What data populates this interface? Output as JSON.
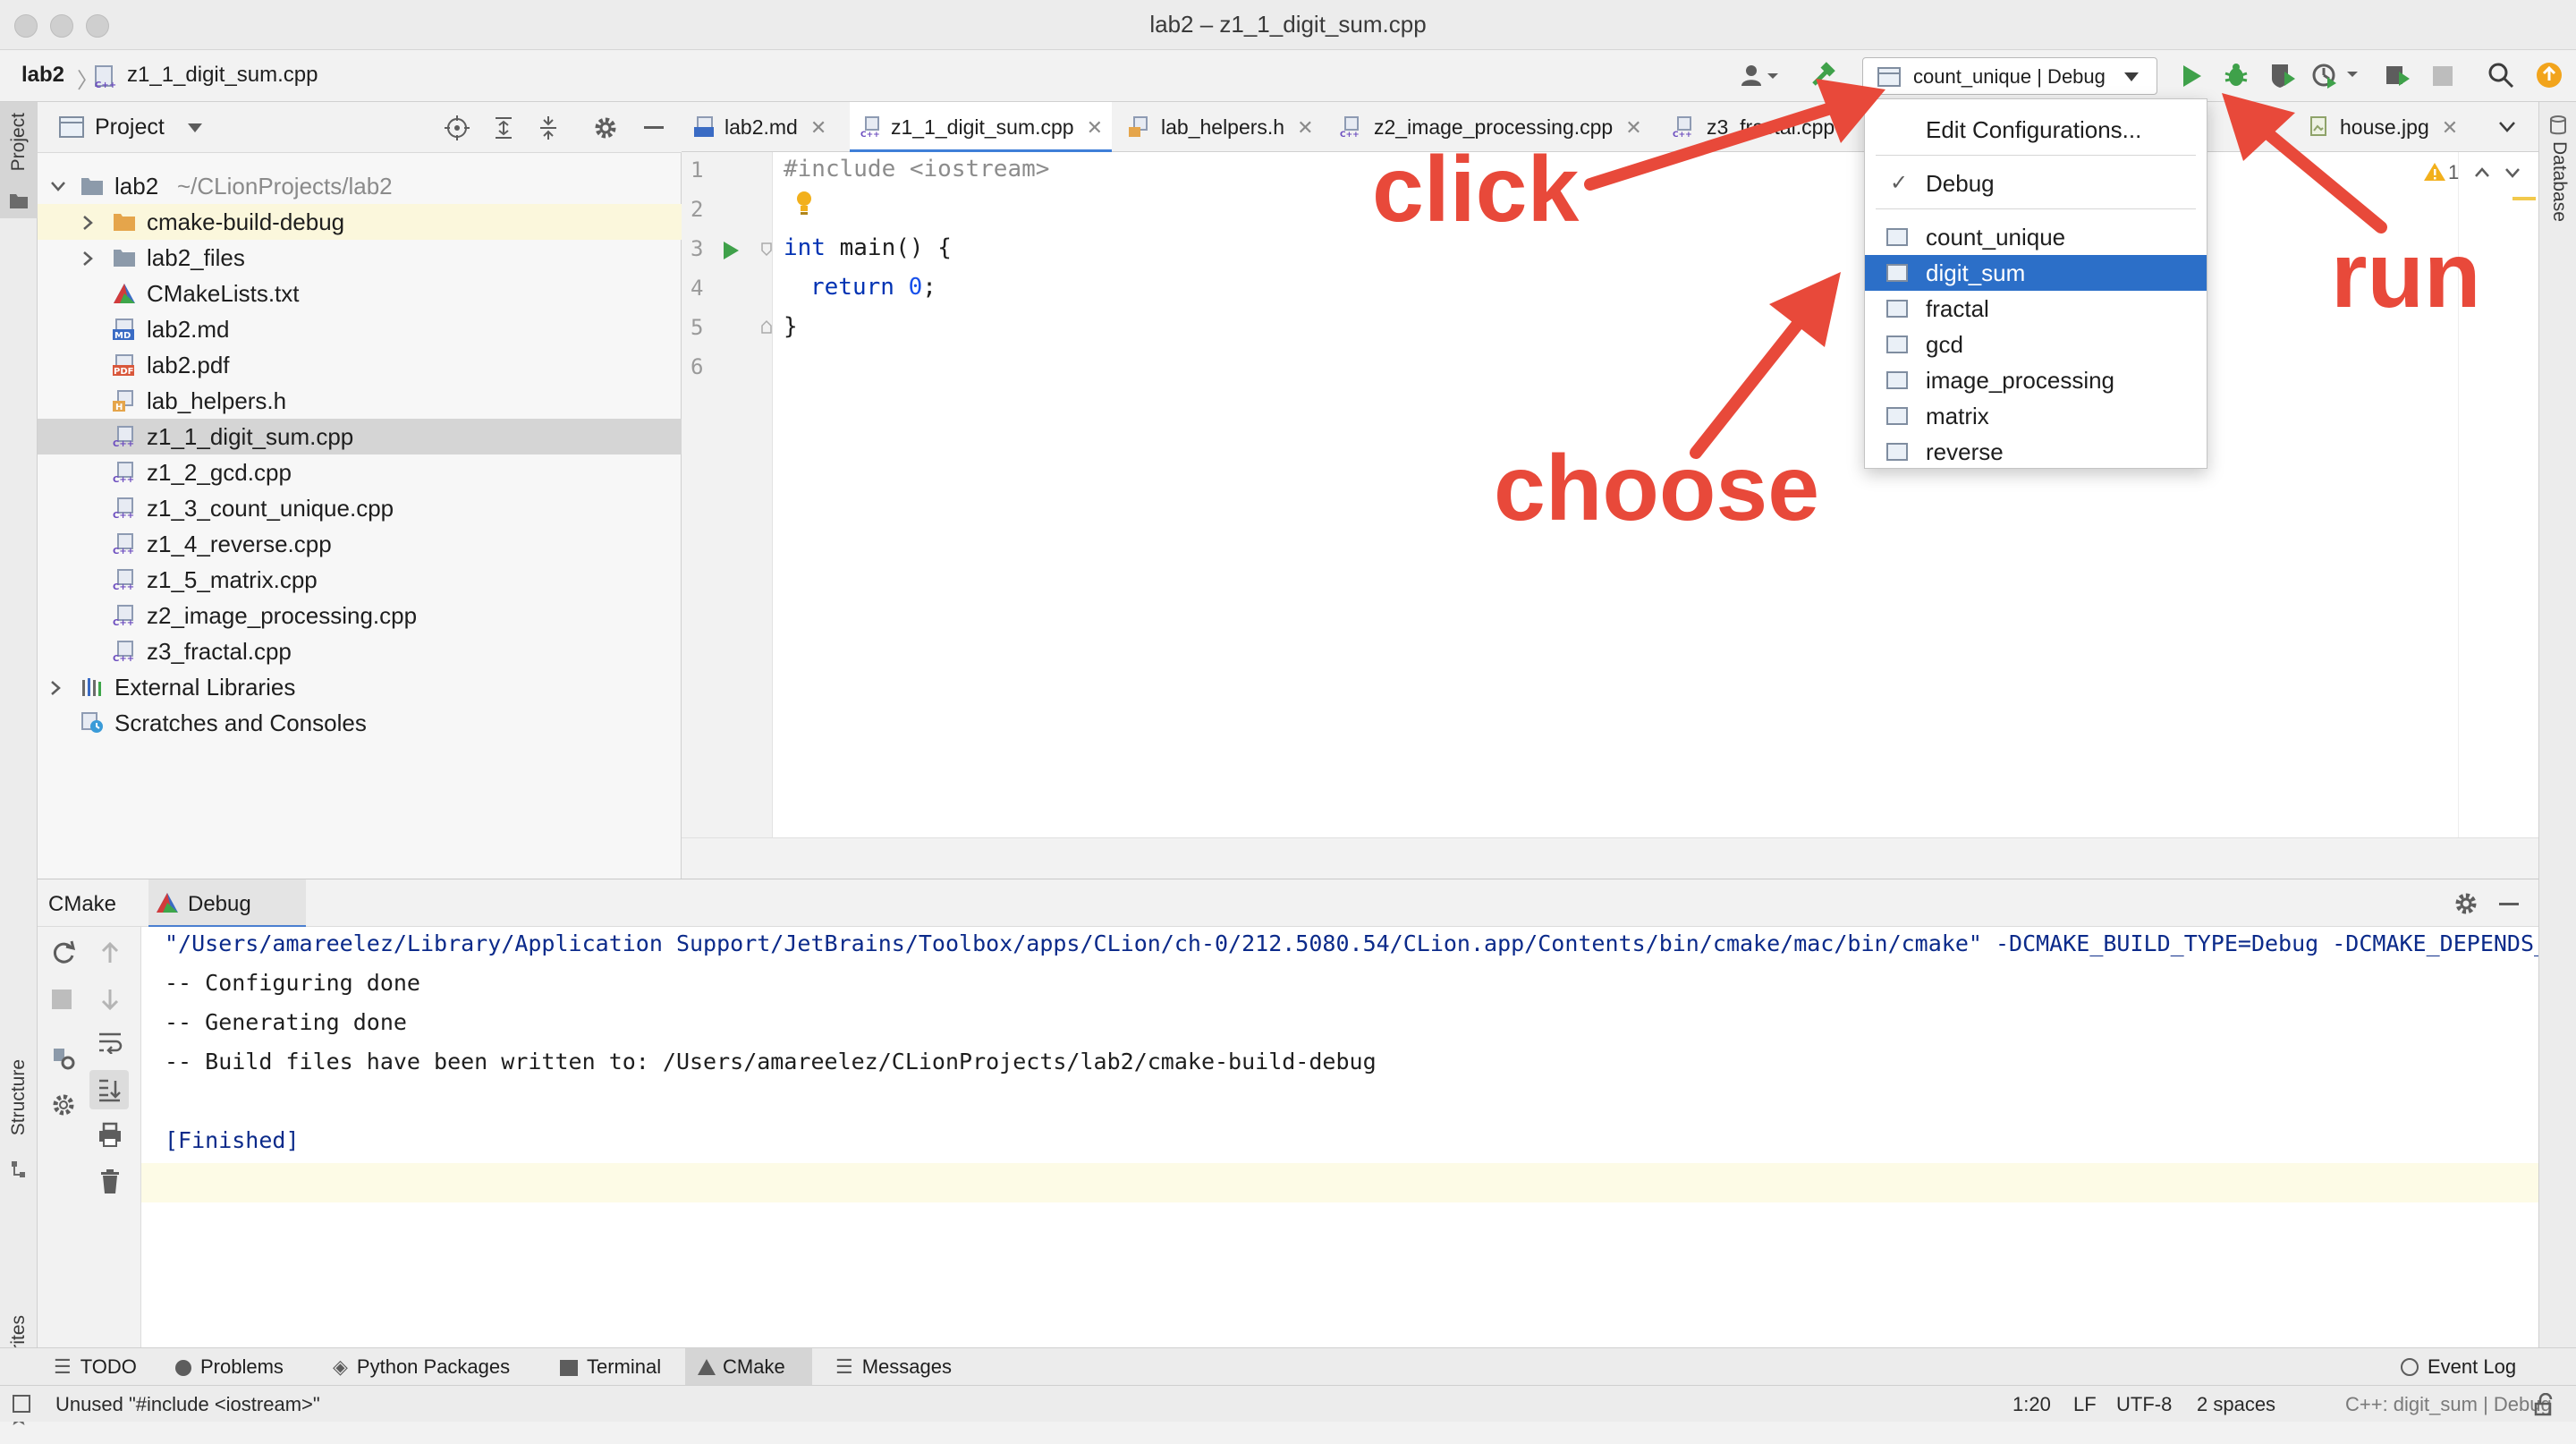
{
  "window": {
    "title": "lab2 – z1_1_digit_sum.cpp"
  },
  "navbar": {
    "project": "lab2",
    "file": "z1_1_digit_sum.cpp",
    "run_config": "count_unique | Debug"
  },
  "left_stripe": {
    "project": "Project",
    "structure": "Structure",
    "favorites": "Favorites"
  },
  "right_stripe": {
    "database": "Database"
  },
  "project_panel": {
    "title": "Project",
    "root": {
      "name": "lab2",
      "path": "~/CLionProjects/lab2"
    },
    "items": [
      {
        "name": "cmake-build-debug",
        "type": "folder-orange"
      },
      {
        "name": "lab2_files",
        "type": "folder"
      },
      {
        "name": "CMakeLists.txt",
        "type": "cmake"
      },
      {
        "name": "lab2.md",
        "type": "md"
      },
      {
        "name": "lab2.pdf",
        "type": "pdf"
      },
      {
        "name": "lab_helpers.h",
        "type": "header"
      },
      {
        "name": "z1_1_digit_sum.cpp",
        "type": "cpp"
      },
      {
        "name": "z1_2_gcd.cpp",
        "type": "cpp"
      },
      {
        "name": "z1_3_count_unique.cpp",
        "type": "cpp"
      },
      {
        "name": "z1_4_reverse.cpp",
        "type": "cpp"
      },
      {
        "name": "z1_5_matrix.cpp",
        "type": "cpp"
      },
      {
        "name": "z2_image_processing.cpp",
        "type": "cpp"
      },
      {
        "name": "z3_fractal.cpp",
        "type": "cpp"
      }
    ],
    "external_libraries": "External Libraries",
    "scratches": "Scratches and Consoles"
  },
  "editor": {
    "tabs": [
      {
        "label": "lab2.md"
      },
      {
        "label": "z1_1_digit_sum.cpp"
      },
      {
        "label": "lab_helpers.h"
      },
      {
        "label": "z2_image_processing.cpp"
      },
      {
        "label": "z3_fractal.cpp"
      },
      {
        "label": "house.jpg"
      }
    ],
    "line_numbers": [
      "1",
      "2",
      "3",
      "4",
      "5",
      "6"
    ],
    "code": {
      "l1": "#include <iostream>",
      "l3_kw": "int",
      "l3_rest": " main() {",
      "l4_kw": "return",
      "l4_num": "0",
      "l4_end": ";",
      "l5": "}"
    },
    "warning_count": "1"
  },
  "dropdown": {
    "edit": "Edit Configurations...",
    "debug": "Debug",
    "configs": [
      "count_unique",
      "digit_sum",
      "fractal",
      "gcd",
      "image_processing",
      "matrix",
      "reverse"
    ],
    "selected": "digit_sum"
  },
  "bottom_panel": {
    "tabs": [
      "CMake",
      "Debug"
    ],
    "console": [
      "\"/Users/amareelez/Library/Application Support/JetBrains/Toolbox/apps/CLion/ch-0/212.5080.54/CLion.app/Contents/bin/cmake/mac/bin/cmake\" -DCMAKE_BUILD_TYPE=Debug -DCMAKE_DEPENDS_USE_COMPILER=FALSE -G \"CodeBlocks - Unix Makefiles\"",
      "-- Configuring done",
      "-- Generating done",
      "-- Build files have been written to: /Users/amareelez/CLionProjects/lab2/cmake-build-debug",
      "",
      "[Finished]"
    ]
  },
  "tool_tabs": [
    "TODO",
    "Problems",
    "Python Packages",
    "Terminal",
    "CMake",
    "Messages"
  ],
  "event_log": "Event Log",
  "status": {
    "message": "Unused \"#include <iostream>\"",
    "position": "1:20",
    "line_sep": "LF",
    "encoding": "UTF-8",
    "indent": "2 spaces",
    "context": "C++: digit_sum | Debug"
  },
  "annotations": {
    "click": "click",
    "choose": "choose",
    "run": "run"
  },
  "colors": {
    "accent": "#2c6fc8",
    "annotation": "#e8493a",
    "run": "#3fa14a",
    "keyword": "#0033b3"
  }
}
